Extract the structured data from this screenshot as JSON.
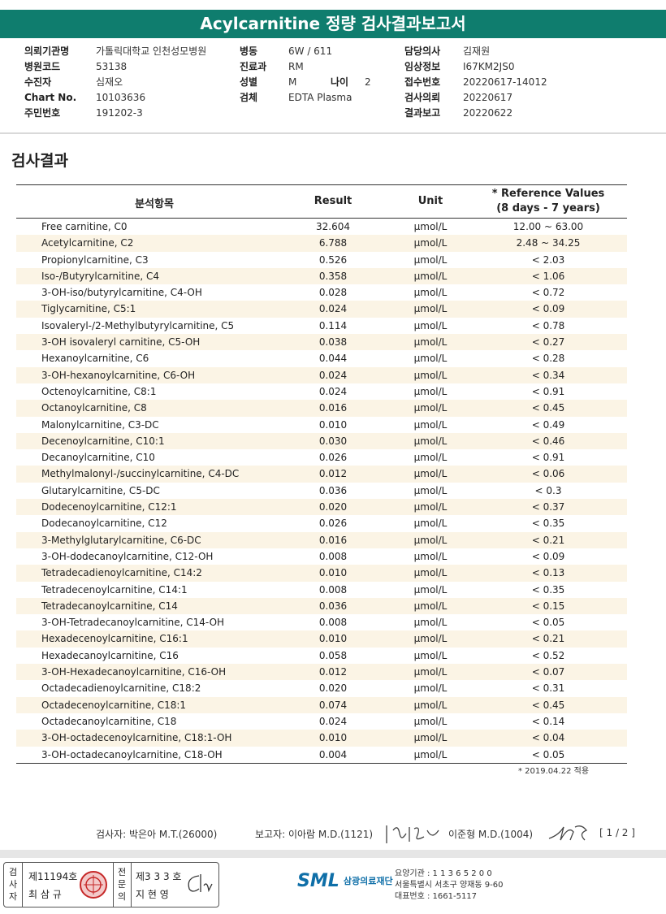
{
  "header": {
    "title": "Acylcarnitine 정량 검사결과보고서"
  },
  "patient_info": {
    "col1": [
      {
        "label": "의뢰기관명",
        "value": "가톨릭대학교 인천성모병원"
      },
      {
        "label": "병원코드",
        "value": "53138"
      },
      {
        "label": "수진자",
        "value": "심재오"
      },
      {
        "label": "Chart No.",
        "value": "10103636"
      },
      {
        "label": "주민번호",
        "value": "191202-3"
      }
    ],
    "col2": [
      {
        "label": "병동",
        "value": "6W / 611"
      },
      {
        "label": "진료과",
        "value": "RM"
      },
      {
        "label": "성별",
        "value": "M"
      },
      {
        "label": "검체",
        "value": "EDTA Plasma"
      }
    ],
    "age": {
      "label": "나이",
      "value": "2"
    },
    "col3": [
      {
        "label": "담당의사",
        "value": "김재원"
      },
      {
        "label": "임상정보",
        "value": "I67KM2JS0"
      },
      {
        "label": "접수번호",
        "value": "20220617-14012"
      },
      {
        "label": "검사의뢰",
        "value": "20220617"
      },
      {
        "label": "결과보고",
        "value": "20220622"
      }
    ]
  },
  "section_title": "검사결과",
  "table": {
    "headers": {
      "item": "분석항목",
      "result": "Result",
      "unit": "Unit",
      "ref_line1": "* Reference Values",
      "ref_line2": "(8 days - 7 years)"
    },
    "rows": [
      {
        "name": "Free carnitine, C0",
        "result": "32.604",
        "unit": "μmol/L",
        "ref": "12.00 ~ 63.00"
      },
      {
        "name": "Acetylcarnitine, C2",
        "result": "6.788",
        "unit": "μmol/L",
        "ref": "2.48 ~ 34.25"
      },
      {
        "name": "Propionylcarnitine, C3",
        "result": "0.526",
        "unit": "μmol/L",
        "ref": "< 2.03"
      },
      {
        "name": "Iso-/Butyrylcarnitine, C4",
        "result": "0.358",
        "unit": "μmol/L",
        "ref": "< 1.06"
      },
      {
        "name": "3-OH-iso/butyrylcarnitine, C4-OH",
        "result": "0.028",
        "unit": "μmol/L",
        "ref": "< 0.72"
      },
      {
        "name": "Tiglycarnitine, C5:1",
        "result": "0.024",
        "unit": "μmol/L",
        "ref": "< 0.09"
      },
      {
        "name": "Isovaleryl-/2-Methylbutyrylcarnitine, C5",
        "result": "0.114",
        "unit": "μmol/L",
        "ref": "< 0.78"
      },
      {
        "name": "3-OH isovaleryl carnitine, C5-OH",
        "result": "0.038",
        "unit": "μmol/L",
        "ref": "< 0.27"
      },
      {
        "name": "Hexanoylcarnitine, C6",
        "result": "0.044",
        "unit": "μmol/L",
        "ref": "< 0.28"
      },
      {
        "name": "3-OH-hexanoylcarnitine, C6-OH",
        "result": "0.024",
        "unit": "μmol/L",
        "ref": "< 0.34"
      },
      {
        "name": "Octenoylcarnitine, C8:1",
        "result": "0.024",
        "unit": "μmol/L",
        "ref": "< 0.91"
      },
      {
        "name": "Octanoylcarnitine, C8",
        "result": "0.016",
        "unit": "μmol/L",
        "ref": "< 0.45"
      },
      {
        "name": "Malonylcarnitine, C3-DC",
        "result": "0.010",
        "unit": "μmol/L",
        "ref": "< 0.49"
      },
      {
        "name": "Decenoylcarnitine, C10:1",
        "result": "0.030",
        "unit": "μmol/L",
        "ref": "< 0.46"
      },
      {
        "name": "Decanoylcarnitine, C10",
        "result": "0.026",
        "unit": "μmol/L",
        "ref": "< 0.91"
      },
      {
        "name": "Methylmalonyl-/succinylcarnitine, C4-DC",
        "result": "0.012",
        "unit": "μmol/L",
        "ref": "< 0.06"
      },
      {
        "name": "Glutarylcarnitine, C5-DC",
        "result": "0.036",
        "unit": "μmol/L",
        "ref": "< 0.3"
      },
      {
        "name": "Dodecenoylcarnitine, C12:1",
        "result": "0.020",
        "unit": "μmol/L",
        "ref": "< 0.37"
      },
      {
        "name": "Dodecanoylcarnitine, C12",
        "result": "0.026",
        "unit": "μmol/L",
        "ref": "< 0.35"
      },
      {
        "name": "3-Methylglutarylcarnitine, C6-DC",
        "result": "0.016",
        "unit": "μmol/L",
        "ref": "< 0.21"
      },
      {
        "name": "3-OH-dodecanoylcarnitine, C12-OH",
        "result": "0.008",
        "unit": "μmol/L",
        "ref": "< 0.09"
      },
      {
        "name": "Tetradecadienoylcarnitine, C14:2",
        "result": "0.010",
        "unit": "μmol/L",
        "ref": "< 0.13"
      },
      {
        "name": "Tetradecenoylcarnitine, C14:1",
        "result": "0.008",
        "unit": "μmol/L",
        "ref": "< 0.35"
      },
      {
        "name": "Tetradecanoylcarnitine, C14",
        "result": "0.036",
        "unit": "μmol/L",
        "ref": "< 0.15"
      },
      {
        "name": "3-OH-Tetradecanoylcarnitine, C14-OH",
        "result": "0.008",
        "unit": "μmol/L",
        "ref": "< 0.05"
      },
      {
        "name": "Hexadecenoylcarnitine, C16:1",
        "result": "0.010",
        "unit": "μmol/L",
        "ref": "< 0.21"
      },
      {
        "name": "Hexadecanoylcarnitine, C16",
        "result": "0.058",
        "unit": "μmol/L",
        "ref": "< 0.52"
      },
      {
        "name": "3-OH-Hexadecanoylcarnitine, C16-OH",
        "result": "0.012",
        "unit": "μmol/L",
        "ref": "< 0.07"
      },
      {
        "name": "Octadecadienoylcarnitine, C18:2",
        "result": "0.020",
        "unit": "μmol/L",
        "ref": "< 0.31"
      },
      {
        "name": "Octadecenoylcarnitine, C18:1",
        "result": "0.074",
        "unit": "μmol/L",
        "ref": "< 0.45"
      },
      {
        "name": "Octadecanoylcarnitine, C18",
        "result": "0.024",
        "unit": "μmol/L",
        "ref": "< 0.14"
      },
      {
        "name": "3-OH-octadecenoylcarnitine, C18:1-OH",
        "result": "0.010",
        "unit": "μmol/L",
        "ref": "< 0.04"
      },
      {
        "name": "3-OH-octadecanoylcarnitine, C18-OH",
        "result": "0.004",
        "unit": "μmol/L",
        "ref": "< 0.05"
      }
    ]
  },
  "footnote": "* 2019.04.22 적용",
  "signatures": {
    "tester": "검사자: 박은아 M.T.(26000)",
    "reporter": "보고자: 이아람 M.D.(1121)",
    "reporter2": "이준형 M.D.(1004)",
    "page": "[ 1 / 2 ]"
  },
  "certificate": {
    "v1": "검사자",
    "no1": "제11194호",
    "name1": "최 삼 규",
    "v2": "전문의",
    "no2": "제3 3 3 호",
    "name2": "지 현 영"
  },
  "lab": {
    "logo": "SML",
    "name": "삼광의료재단",
    "line1": "요양기관 : 1 1 3 6 5 2 0 0",
    "line2": "서울특별시 서초구 양재동 9-60",
    "line3": "대표번호 : 1661-5117"
  }
}
